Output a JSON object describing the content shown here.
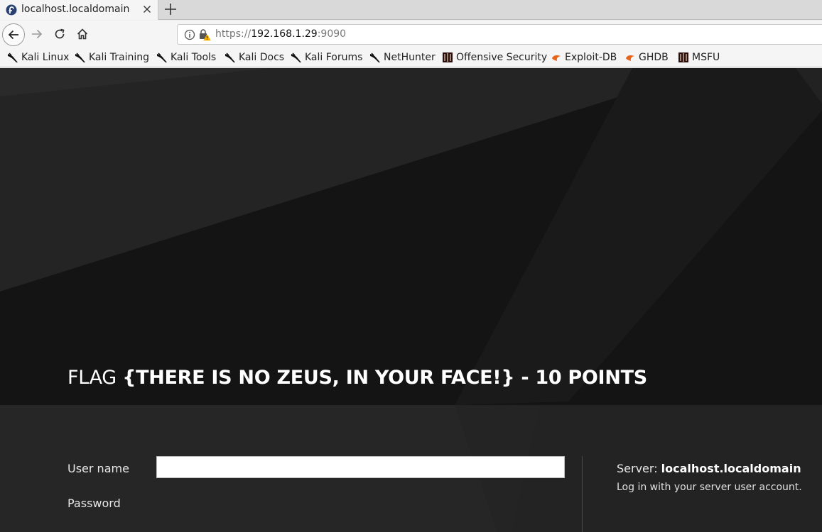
{
  "tab": {
    "title": "localhost.localdomain"
  },
  "navbar": {
    "url_scheme": "https://",
    "url_host": "192.168.1.29",
    "url_port": ":9090"
  },
  "bookmarks": [
    {
      "label": "Kali Linux",
      "icon": "kali-dragon-icon"
    },
    {
      "label": "Kali Training",
      "icon": "kali-dragon-icon"
    },
    {
      "label": "Kali Tools",
      "icon": "kali-dragon-icon"
    },
    {
      "label": "Kali Docs",
      "icon": "kali-dragon-icon"
    },
    {
      "label": "Kali Forums",
      "icon": "kali-dragon-icon"
    },
    {
      "label": "NetHunter",
      "icon": "kali-dragon-icon"
    },
    {
      "label": "Offensive Security",
      "icon": "offsec-icon"
    },
    {
      "label": "Exploit-DB",
      "icon": "exploit-db-icon"
    },
    {
      "label": "GHDB",
      "icon": "exploit-db-icon"
    },
    {
      "label": "MSFU",
      "icon": "offsec-icon"
    }
  ],
  "page": {
    "flag_prefix": "FLAG ",
    "flag_text": "{THERE IS NO ZEUS, IN YOUR FACE!} - 10 POINTS",
    "username_label": "User name",
    "username_value": "",
    "password_label": "Password",
    "server_label": "Server: ",
    "server_name": "localhost.localdomain",
    "login_hint": "Log in with your server user account."
  },
  "colors": {
    "page_background": "#141414",
    "login_background": "#262626",
    "browser_chrome": "#f5f5f5"
  }
}
